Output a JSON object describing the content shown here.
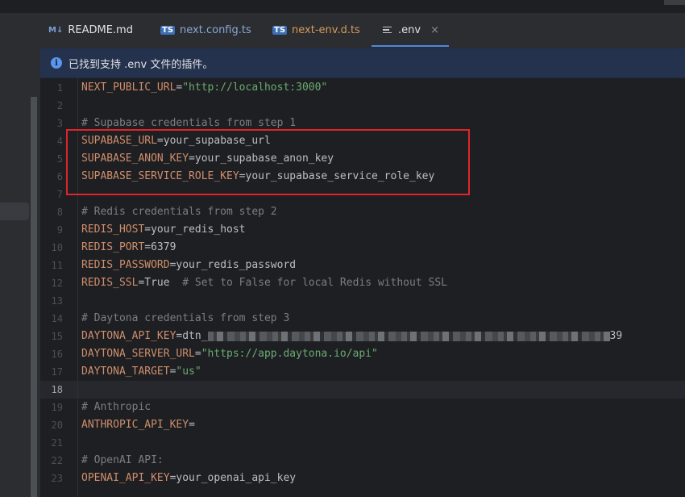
{
  "tabs": [
    {
      "name": "readme",
      "icon": "markdown-icon",
      "icon_text": "M↓",
      "label": "README.md",
      "color": "#8aa8d6"
    },
    {
      "name": "next-config",
      "icon": "typescript-icon",
      "icon_text": "TS",
      "label": "next.config.ts",
      "color": "#8aa8d6"
    },
    {
      "name": "next-env",
      "icon": "typescript-icon",
      "icon_text": "TS",
      "label": "next-env.d.ts",
      "color": "#d59b5a"
    },
    {
      "name": "env",
      "icon": "text-file-icon",
      "label": ".env",
      "active": true,
      "close": "×"
    }
  ],
  "banner": {
    "icon": "info-icon",
    "icon_text": "i",
    "message": "已找到支持 .env 文件的插件。"
  },
  "editor": {
    "current_line": 18,
    "lines": [
      {
        "n": "1",
        "key": "NEXT_PUBLIC_URL",
        "eq": "=",
        "value": "\"http://localhost:3000\"",
        "type": "string"
      },
      {
        "n": "2"
      },
      {
        "n": "3",
        "comment": "# Supabase credentials from step 1"
      },
      {
        "n": "4",
        "key": "SUPABASE_URL",
        "eq": "=",
        "value": "your_supabase_url",
        "type": "plain"
      },
      {
        "n": "5",
        "key": "SUPABASE_ANON_KEY",
        "eq": "=",
        "value": "your_supabase_anon_key",
        "type": "plain"
      },
      {
        "n": "6",
        "key": "SUPABASE_SERVICE_ROLE_KEY",
        "eq": "=",
        "value": "your_supabase_service_role_key",
        "type": "plain"
      },
      {
        "n": "7"
      },
      {
        "n": "8",
        "comment": "# Redis credentials from step 2"
      },
      {
        "n": "9",
        "key": "REDIS_HOST",
        "eq": "=",
        "value": "your_redis_host",
        "type": "plain"
      },
      {
        "n": "10",
        "key": "REDIS_PORT",
        "eq": "=",
        "value": "6379",
        "type": "plain"
      },
      {
        "n": "11",
        "key": "REDIS_PASSWORD",
        "eq": "=",
        "value": "your_redis_password",
        "type": "plain"
      },
      {
        "n": "12",
        "key": "REDIS_SSL",
        "eq": "=",
        "value": "True",
        "type": "plain",
        "trail": "  # Set to False for local Redis without SSL"
      },
      {
        "n": "13"
      },
      {
        "n": "14",
        "comment": "# Daytona credentials from step 3"
      },
      {
        "n": "15",
        "key": "DAYTONA_API_KEY",
        "eq": "=",
        "value": "dtn_",
        "type": "plain",
        "redacted": true,
        "tail": "39"
      },
      {
        "n": "16",
        "key": "DAYTONA_SERVER_URL",
        "eq": "=",
        "value": "\"https://app.daytona.io/api\"",
        "type": "string"
      },
      {
        "n": "17",
        "key": "DAYTONA_TARGET",
        "eq": "=",
        "value": "\"us\"",
        "type": "string"
      },
      {
        "n": "18"
      },
      {
        "n": "19",
        "comment": "# Anthropic"
      },
      {
        "n": "20",
        "key": "ANTHROPIC_API_KEY",
        "eq": "=",
        "value": "",
        "type": "plain"
      },
      {
        "n": "21"
      },
      {
        "n": "22",
        "comment": "# OpenAI API:"
      },
      {
        "n": "23",
        "key": "OPENAI_API_KEY",
        "eq": "=",
        "value": "your_openai_api_key",
        "type": "plain"
      }
    ]
  },
  "highlight": {
    "color": "#e0242b",
    "covers_lines": [
      3,
      4,
      5,
      6
    ]
  }
}
